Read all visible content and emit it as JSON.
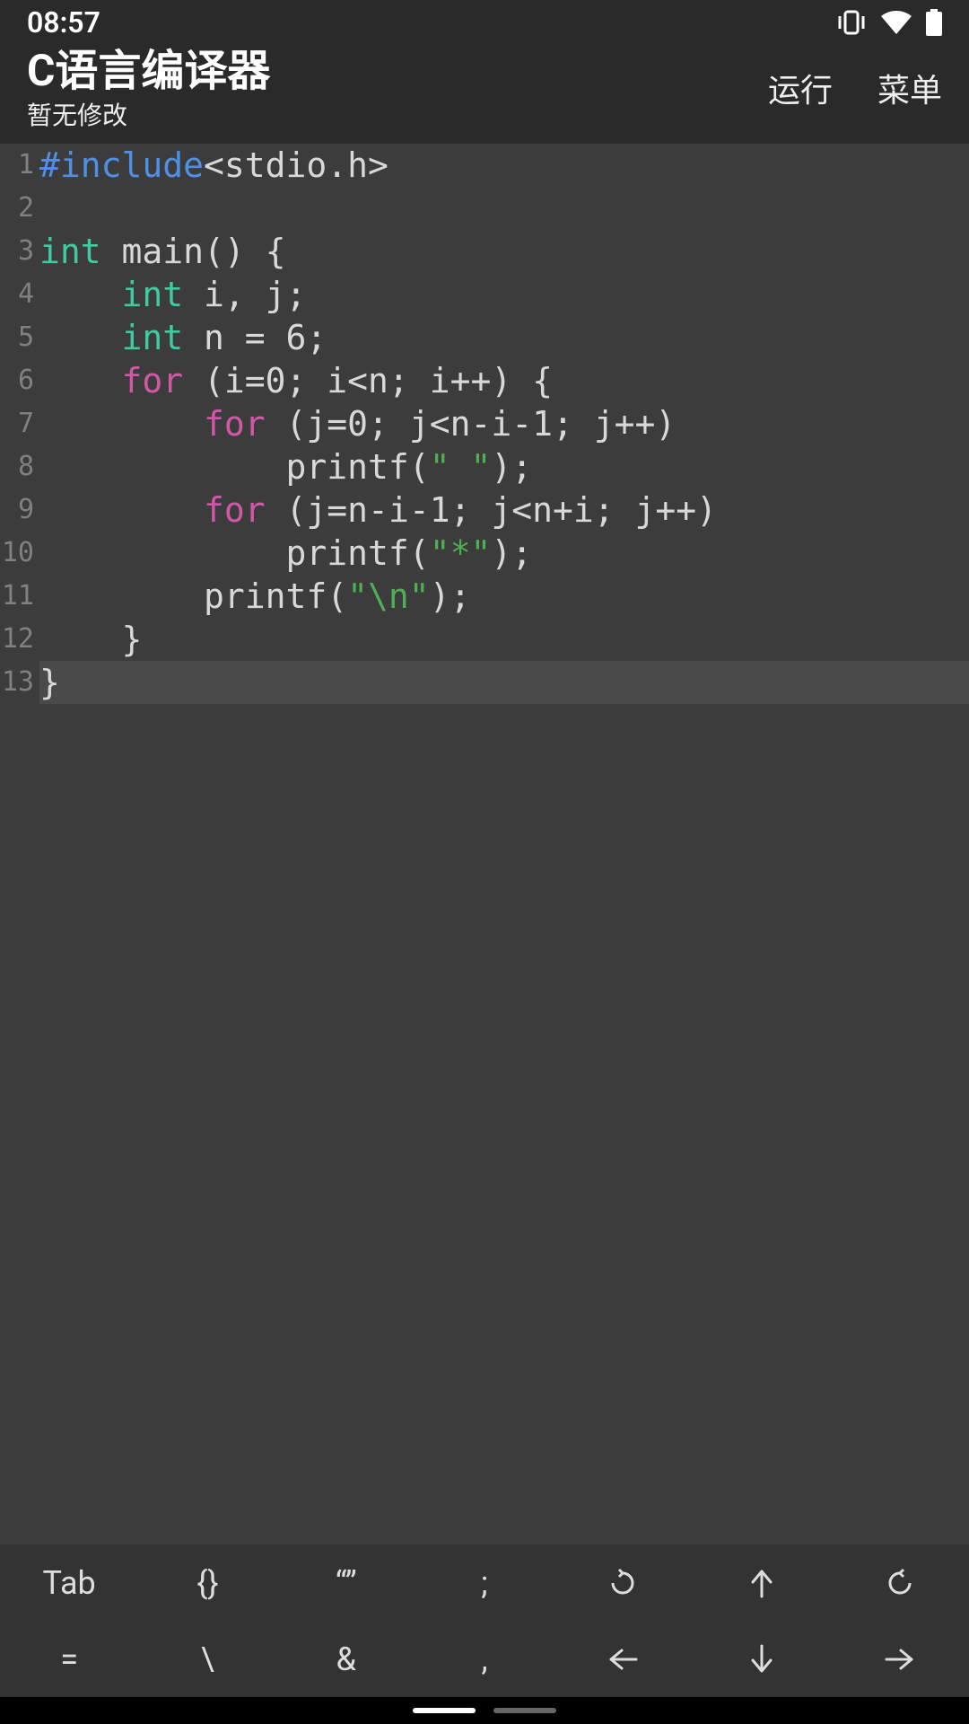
{
  "status": {
    "time": "08:57"
  },
  "header": {
    "title": "C语言编译器",
    "subtitle": "暂无修改",
    "run": "运行",
    "menu": "菜单"
  },
  "code": {
    "lines": [
      {
        "n": "1",
        "tokens": [
          [
            "pp",
            "#include"
          ],
          [
            "plain",
            "<stdio.h>"
          ]
        ]
      },
      {
        "n": "2",
        "tokens": []
      },
      {
        "n": "3",
        "tokens": [
          [
            "kw",
            "int"
          ],
          [
            "plain",
            " main() {"
          ]
        ]
      },
      {
        "n": "4",
        "tokens": [
          [
            "plain",
            "    "
          ],
          [
            "kw",
            "int"
          ],
          [
            "plain",
            " i, j;"
          ]
        ]
      },
      {
        "n": "5",
        "tokens": [
          [
            "plain",
            "    "
          ],
          [
            "kw",
            "int"
          ],
          [
            "plain",
            " n = 6;"
          ]
        ]
      },
      {
        "n": "6",
        "tokens": [
          [
            "plain",
            "    "
          ],
          [
            "ctrl",
            "for"
          ],
          [
            "plain",
            " (i=0; i<n; i++) {"
          ]
        ]
      },
      {
        "n": "7",
        "tokens": [
          [
            "plain",
            "        "
          ],
          [
            "ctrl",
            "for"
          ],
          [
            "plain",
            " (j=0; j<n-i-1; j++)"
          ]
        ]
      },
      {
        "n": "8",
        "tokens": [
          [
            "plain",
            "            printf("
          ],
          [
            "str",
            "\" \""
          ],
          [
            "plain",
            ");"
          ]
        ]
      },
      {
        "n": "9",
        "tokens": [
          [
            "plain",
            "        "
          ],
          [
            "ctrl",
            "for"
          ],
          [
            "plain",
            " (j=n-i-1; j<n+i; j++)"
          ]
        ]
      },
      {
        "n": "10",
        "tokens": [
          [
            "plain",
            "            printf("
          ],
          [
            "str",
            "\"*\""
          ],
          [
            "plain",
            ");"
          ]
        ]
      },
      {
        "n": "11",
        "tokens": [
          [
            "plain",
            "        printf("
          ],
          [
            "str",
            "\"\\n\""
          ],
          [
            "plain",
            ");"
          ]
        ]
      },
      {
        "n": "12",
        "tokens": [
          [
            "plain",
            "    }"
          ]
        ]
      },
      {
        "n": "13",
        "tokens": [
          [
            "plain",
            "}"
          ]
        ],
        "hl": true
      }
    ]
  },
  "toolbar": {
    "row1": [
      "Tab",
      "{}",
      "“”",
      ";",
      "undo-icon",
      "arrow-up-icon",
      "redo-icon"
    ],
    "row2": [
      "=",
      "\\",
      "&",
      ",",
      "arrow-left-icon",
      "arrow-down-icon",
      "arrow-right-icon"
    ]
  }
}
